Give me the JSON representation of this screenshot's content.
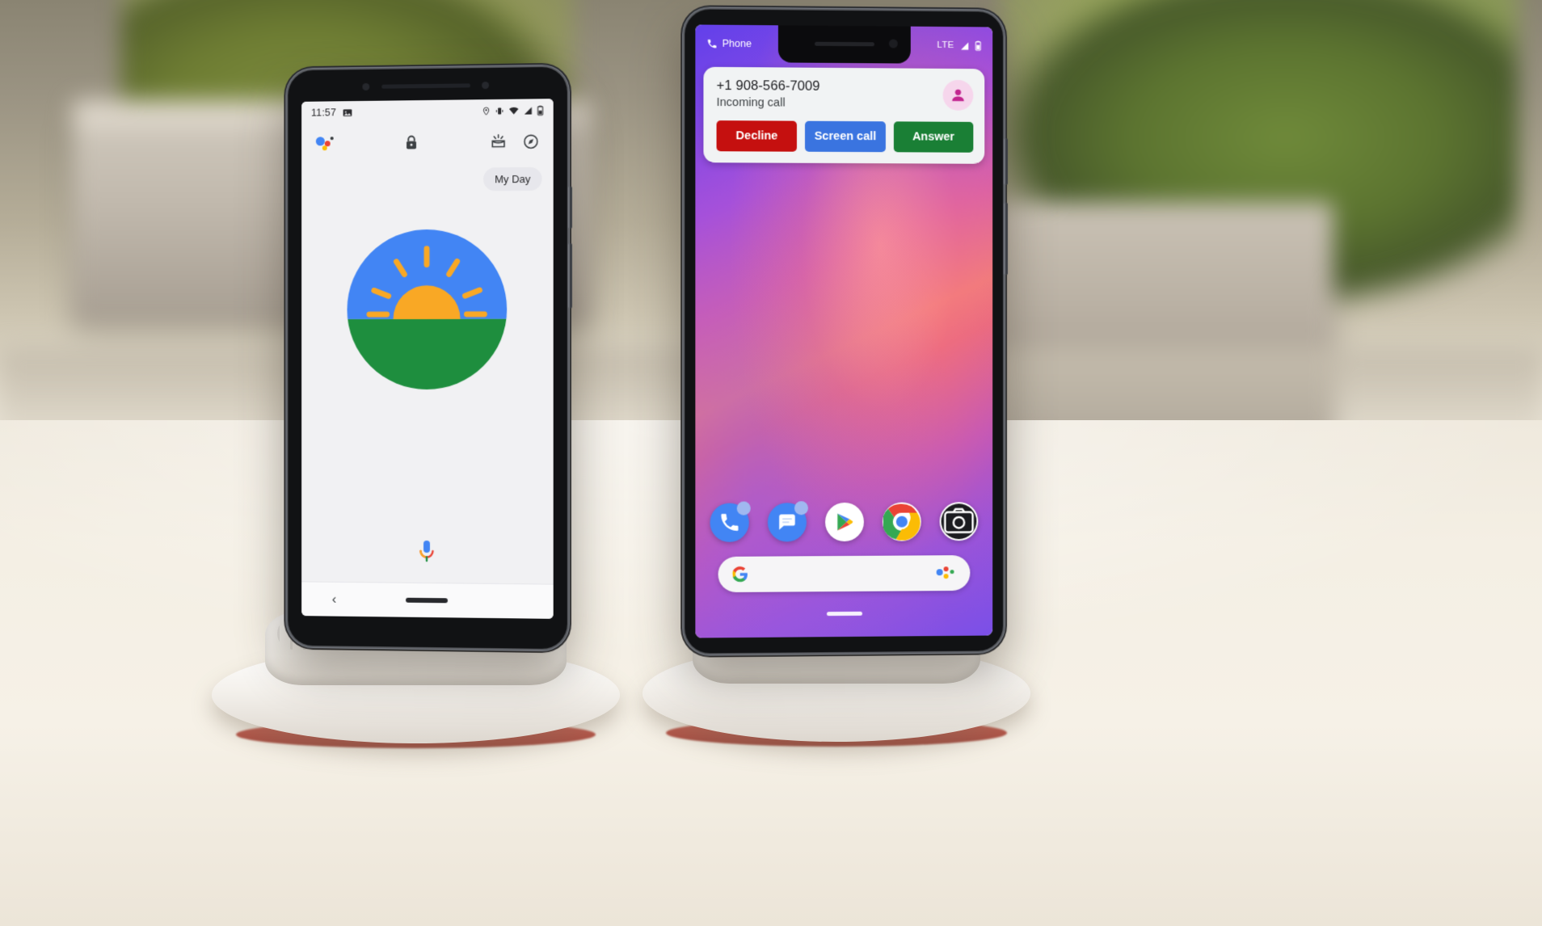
{
  "scene": {
    "description": "Two Google Pixel 3 phones standing on white wireless charging stands on a desk with blurred potted plants behind",
    "background_colors": {
      "desk": "#f2ece0",
      "plant_green": "#6e7d33",
      "pot_gray": "#c2baae"
    }
  },
  "left_phone": {
    "device_name": "Pixel 3",
    "body_color": "#111214",
    "status_bar": {
      "time": "11:57",
      "left_icons": [
        "photo-icon"
      ],
      "right_icons": [
        "location-pin-icon",
        "vibrate-icon",
        "wifi-icon",
        "signal-icon",
        "battery-icon"
      ]
    },
    "assistant_header": {
      "icons": [
        "assistant-dots-icon",
        "lock-icon",
        "snapshot-icon",
        "explore-icon"
      ]
    },
    "chip": {
      "label": "My Day"
    },
    "illustration": {
      "name": "sunrise-illustration",
      "sky_color": "#4285f4",
      "sun_color": "#f9a825",
      "ground_color": "#1e8e3e"
    },
    "mic": {
      "name": "assistant-mic-icon"
    },
    "nav_bar": {
      "back_label": "‹",
      "home_pill": "home-pill"
    }
  },
  "right_phone": {
    "device_name": "Pixel 3 XL",
    "body_color": "#111214",
    "status_bar": {
      "app_label": "Phone",
      "app_icon": "phone-handset-icon",
      "network_label": "LTE",
      "right_icons": [
        "signal-icon",
        "battery-icon"
      ]
    },
    "call_notification": {
      "phone_number": "+1 908-566-7009",
      "status_text": "Incoming call",
      "avatar": "contact-avatar-icon",
      "avatar_bg_color": "#f6d6ec",
      "avatar_fg_color": "#c2258f",
      "buttons": [
        {
          "label": "Decline",
          "color": "#c5100f"
        },
        {
          "label": "Screen call",
          "color": "#3a74e0"
        },
        {
          "label": "Answer",
          "color": "#1a7f35"
        }
      ]
    },
    "wallpaper": {
      "name": "gradient-wallpaper",
      "colors": [
        "#6240ea",
        "#d75fa8",
        "#ef7b7c",
        "#9b54d8"
      ]
    },
    "dock_apps": [
      {
        "name": "phone-app-icon",
        "label": "Phone",
        "has_badge": true
      },
      {
        "name": "messages-app-icon",
        "label": "Messages",
        "has_badge": true
      },
      {
        "name": "play-store-app-icon",
        "label": "Play Store",
        "has_badge": false
      },
      {
        "name": "chrome-app-icon",
        "label": "Chrome",
        "has_badge": false
      },
      {
        "name": "camera-app-icon",
        "label": "Camera",
        "has_badge": false
      }
    ],
    "search_bar": {
      "name": "google-search-bar",
      "logo": "google-g-icon",
      "assistant_icon": "assistant-dots-icon",
      "placeholder": ""
    },
    "nav_bar": {
      "home_pill": "home-pill"
    }
  }
}
